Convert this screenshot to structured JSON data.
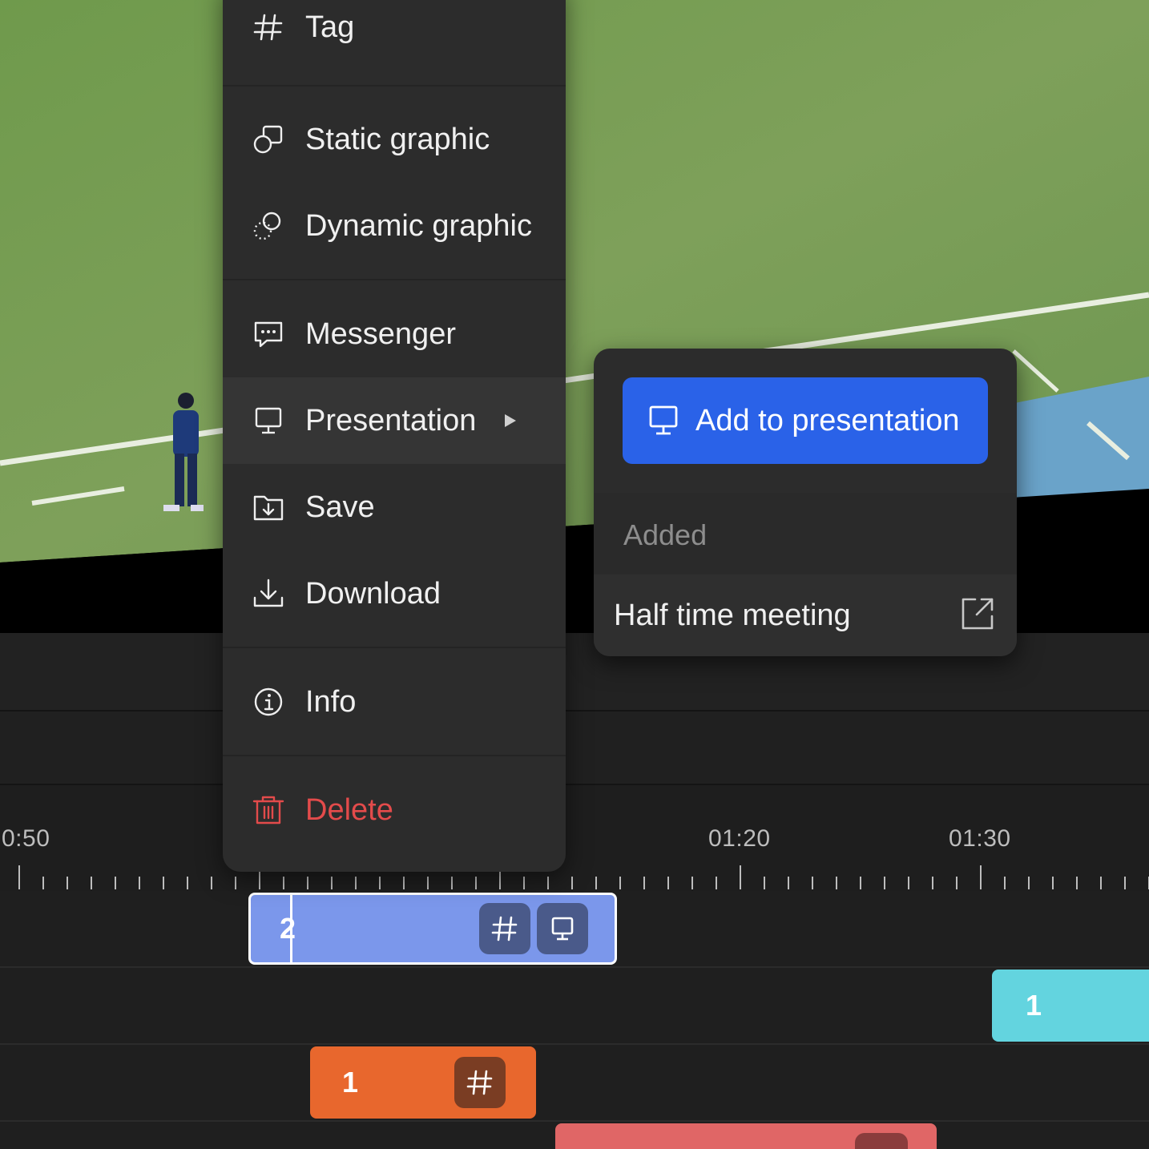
{
  "menu": {
    "items": [
      {
        "label": "Tag",
        "icon": "hash-icon"
      },
      {
        "label": "Static graphic",
        "icon": "static-graphic-icon"
      },
      {
        "label": "Dynamic graphic",
        "icon": "dynamic-graphic-icon"
      },
      {
        "label": "Messenger",
        "icon": "chat-icon"
      },
      {
        "label": "Presentation",
        "icon": "presentation-icon",
        "active": true,
        "has_submenu": true
      },
      {
        "label": "Save",
        "icon": "folder-save-icon"
      },
      {
        "label": "Download",
        "icon": "download-icon"
      },
      {
        "label": "Info",
        "icon": "info-icon"
      },
      {
        "label": "Delete",
        "icon": "trash-icon",
        "danger": true
      }
    ]
  },
  "submenu": {
    "add_button_label": "Add to presentation",
    "section_label": "Added",
    "presentations": [
      {
        "name": "Half time meeting",
        "icon": "external-link-icon"
      }
    ]
  },
  "timeline": {
    "time_labels": [
      "0:50",
      "01:20",
      "01:30"
    ],
    "clips": [
      {
        "label": "2",
        "color": "#7b97eb",
        "selected": true,
        "badges": [
          "hash-icon",
          "presentation-icon"
        ]
      },
      {
        "label": "1",
        "color": "#63d4df",
        "badges": []
      },
      {
        "label": "1",
        "color": "#e8672d",
        "badges": [
          "hash-icon"
        ]
      },
      {
        "label": "",
        "color": "#e06666",
        "badges": []
      }
    ]
  },
  "colors": {
    "accent": "#2a62e8",
    "danger": "#e34b4b",
    "menu_bg": "#2c2c2c"
  }
}
